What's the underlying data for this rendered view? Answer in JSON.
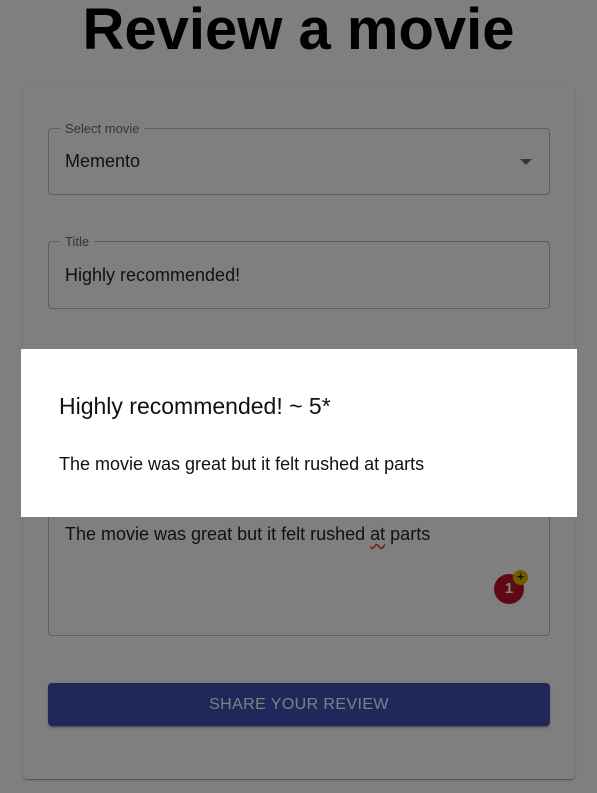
{
  "page": {
    "heading": "Review a movie"
  },
  "form": {
    "movie_field": {
      "label": "Select movie",
      "value": "Memento",
      "caret_icon": "caret-down-icon"
    },
    "title_field": {
      "label": "Title",
      "value": "Highly recommended!"
    },
    "review_field": {
      "value_before": "The movie was great but it felt rushed ",
      "value_flagged": "at",
      "value_after": " parts"
    },
    "extension_badge": {
      "count": "1",
      "plus": "+",
      "color": "#c0102c"
    },
    "submit_label": "Share your review"
  },
  "dialog": {
    "title": "Highly recommended! ~ 5*",
    "body": "The movie was great but it felt rushed at parts"
  },
  "colors": {
    "primary": "#3f51b5",
    "backdrop": "rgba(0,0,0,0.5)"
  }
}
